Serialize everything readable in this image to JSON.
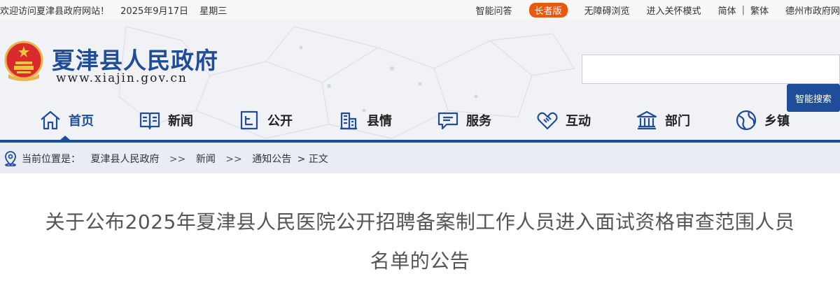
{
  "topbar": {
    "welcome": "欢迎访问夏津县政府网站！",
    "date": "2025年9月17日",
    "weekday": "星期三",
    "links": {
      "qa": "智能问答",
      "elder": "长者版",
      "accessible": "无障碍浏览",
      "care_mode": "进入关怀模式",
      "simplified": "简体",
      "separator": "|",
      "traditional": "繁体",
      "dezhou": "德州市政府网"
    }
  },
  "header": {
    "site_title": "夏津县人民政府",
    "site_domain": "www.xiajin.gov.cn",
    "search_placeholder": "",
    "search_button": "智能搜索",
    "colors": {
      "brand": "#1f4d9a",
      "elder_badge": "#e8590c"
    }
  },
  "nav": {
    "items": [
      {
        "label": "首页",
        "icon": "home-icon",
        "active": true
      },
      {
        "label": "新闻",
        "icon": "newspaper-icon"
      },
      {
        "label": "公开",
        "icon": "document-icon"
      },
      {
        "label": "县情",
        "icon": "building-icon"
      },
      {
        "label": "服务",
        "icon": "chat-icon"
      },
      {
        "label": "互动",
        "icon": "handshake-icon"
      },
      {
        "label": "部门",
        "icon": "institution-icon"
      },
      {
        "label": "乡镇",
        "icon": "globe-icon"
      }
    ]
  },
  "breadcrumb": {
    "prefix": "当前位置是：",
    "items": [
      "夏津县人民政府",
      "新闻",
      "通知公告"
    ],
    "arrow": ">>",
    "current_prefix": "> ",
    "current": "正文"
  },
  "article": {
    "title": "关于公布2025年夏津县人民医院公开招聘备案制工作人员进入面试资格审查范围人员名单的公告"
  }
}
